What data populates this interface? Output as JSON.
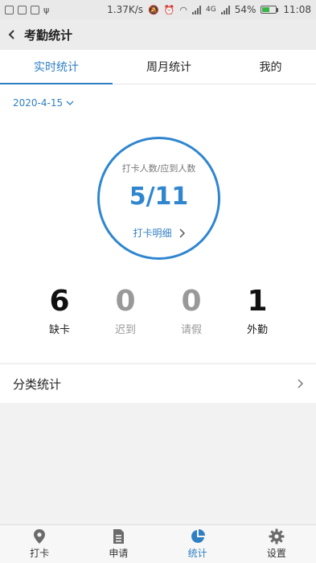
{
  "status_bar": {
    "speed": "1.37K/s",
    "network_label": "4G",
    "battery": "54%",
    "battery_level": 0.54,
    "time": "11:08"
  },
  "header": {
    "title": "考勤统计"
  },
  "tabs": [
    {
      "label": "实时统计",
      "active": true
    },
    {
      "label": "周月统计",
      "active": false
    },
    {
      "label": "我的",
      "active": false
    }
  ],
  "main": {
    "date": "2020-4-15",
    "circle": {
      "label": "打卡人数/应到人数",
      "value": "5/11",
      "link_label": "打卡明细"
    },
    "stats": [
      {
        "value": "6",
        "label": "缺卡",
        "muted": false
      },
      {
        "value": "0",
        "label": "迟到",
        "muted": true
      },
      {
        "value": "0",
        "label": "请假",
        "muted": true
      },
      {
        "value": "1",
        "label": "外勤",
        "muted": false
      }
    ],
    "category_label": "分类统计"
  },
  "bottom_nav": [
    {
      "label": "打卡",
      "icon": "location-pin-icon",
      "active": false
    },
    {
      "label": "申请",
      "icon": "document-icon",
      "active": false
    },
    {
      "label": "统计",
      "icon": "pie-chart-icon",
      "active": true
    },
    {
      "label": "设置",
      "icon": "gear-icon",
      "active": false
    }
  ],
  "colors": {
    "accent": "#2f7fc3",
    "ring": "#2f86cf",
    "muted": "#999999"
  }
}
